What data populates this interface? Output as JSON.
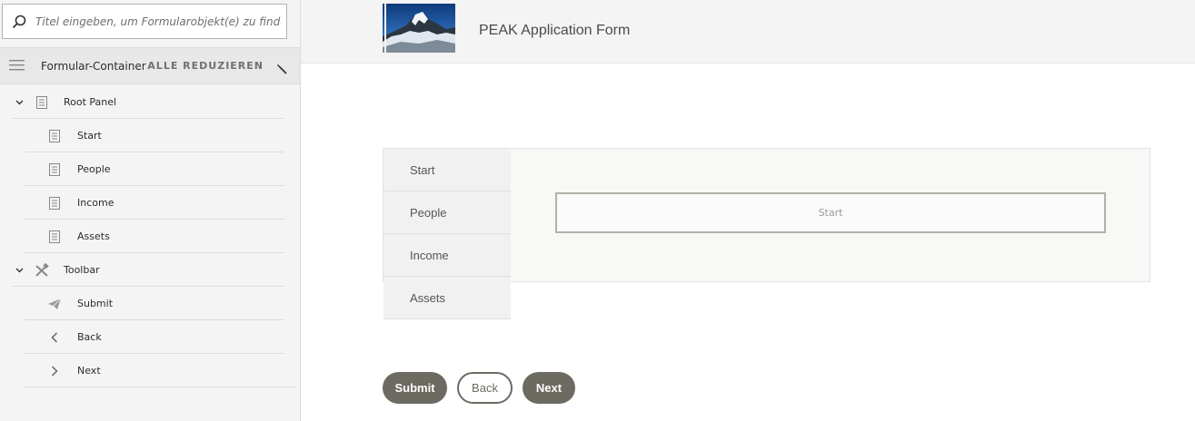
{
  "sidebar": {
    "search": {
      "placeholder": "Titel eingeben, um Formularobjekt(e) zu finden"
    },
    "container_label": "Formular-Container",
    "collapse_all": "ALLE REDUZIEREN",
    "tree": [
      {
        "label": "Root Panel",
        "icon": "panel-icon",
        "level": 0,
        "expanded": true
      },
      {
        "label": "Start",
        "icon": "panel-icon",
        "level": 1
      },
      {
        "label": "People",
        "icon": "panel-icon",
        "level": 1
      },
      {
        "label": "Income",
        "icon": "panel-icon",
        "level": 1
      },
      {
        "label": "Assets",
        "icon": "panel-icon",
        "level": 1
      },
      {
        "label": "Toolbar",
        "icon": "toolbar-icon",
        "level": 0,
        "expanded": true
      },
      {
        "label": "Submit",
        "icon": "paper-plane-icon",
        "level": 1
      },
      {
        "label": "Back",
        "icon": "chevron-left-icon",
        "level": 1
      },
      {
        "label": "Next",
        "icon": "chevron-right-icon",
        "level": 1
      }
    ]
  },
  "form": {
    "title": "PEAK Application Form",
    "tabs": [
      "Start",
      "People",
      "Income",
      "Assets"
    ],
    "active_panel_label": "Start",
    "buttons": {
      "submit": "Submit",
      "back": "Back",
      "next": "Next"
    }
  },
  "colors": {
    "button_dark": "#6c6a61",
    "sidebar_bg": "#f4f4f4"
  }
}
